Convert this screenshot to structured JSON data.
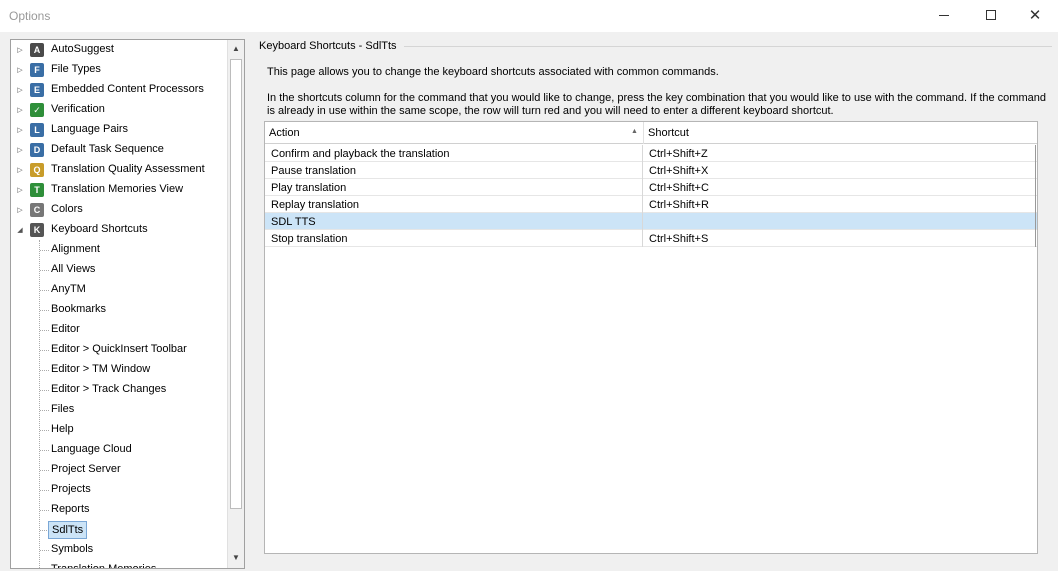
{
  "window": {
    "title": "Options"
  },
  "tree": {
    "items": [
      {
        "label": "AutoSuggest",
        "icon": "autosuggest-icon",
        "color": "#4a4a4a",
        "glyph": "A"
      },
      {
        "label": "File Types",
        "icon": "file-types-icon",
        "color": "#3a6ea5",
        "glyph": "F"
      },
      {
        "label": "Embedded Content Processors",
        "icon": "embedded-content-icon",
        "color": "#3a6ea5",
        "glyph": "E"
      },
      {
        "label": "Verification",
        "icon": "verification-icon",
        "color": "#2f8f3a",
        "glyph": "✓"
      },
      {
        "label": "Language Pairs",
        "icon": "language-pairs-icon",
        "color": "#3a6ea5",
        "glyph": "L"
      },
      {
        "label": "Default Task Sequence",
        "icon": "task-sequence-icon",
        "color": "#3a6ea5",
        "glyph": "D"
      },
      {
        "label": "Translation Quality Assessment",
        "icon": "quality-assessment-icon",
        "color": "#c89c2a",
        "glyph": "Q"
      },
      {
        "label": "Translation Memories View",
        "icon": "translation-memories-icon",
        "color": "#2f8f3a",
        "glyph": "T"
      },
      {
        "label": "Colors",
        "icon": "colors-icon",
        "color": "#777777",
        "glyph": "C"
      },
      {
        "label": "Keyboard Shortcuts",
        "icon": "keyboard-icon",
        "color": "#555555",
        "glyph": "K"
      }
    ],
    "children": [
      {
        "label": "Alignment"
      },
      {
        "label": "All Views"
      },
      {
        "label": "AnyTM"
      },
      {
        "label": "Bookmarks"
      },
      {
        "label": "Editor"
      },
      {
        "label": "Editor > QuickInsert Toolbar"
      },
      {
        "label": "Editor > TM Window"
      },
      {
        "label": "Editor > Track Changes"
      },
      {
        "label": "Files"
      },
      {
        "label": "Help"
      },
      {
        "label": "Language Cloud"
      },
      {
        "label": "Project Server"
      },
      {
        "label": "Projects"
      },
      {
        "label": "Reports"
      },
      {
        "label": "SdlTts"
      },
      {
        "label": "Symbols"
      },
      {
        "label": "Translation Memories"
      }
    ],
    "selected_child": "SdlTts"
  },
  "page": {
    "section_title": "Keyboard Shortcuts - SdlTts",
    "description_1": "This page allows you to change the keyboard shortcuts associated with common commands.",
    "description_2": "In the shortcuts column for the command that you would like to change, press the key combination that you would like to use with the command.  If the command is already in use within the same scope, the row will turn red and you will need to enter a different keyboard shortcut."
  },
  "grid": {
    "columns": {
      "action": "Action",
      "shortcut": "Shortcut"
    },
    "rows": [
      {
        "action": "Confirm and playback the translation",
        "shortcut": "Ctrl+Shift+Z"
      },
      {
        "action": "Pause translation",
        "shortcut": "Ctrl+Shift+X"
      },
      {
        "action": "Play translation",
        "shortcut": "Ctrl+Shift+C"
      },
      {
        "action": "Replay translation",
        "shortcut": "Ctrl+Shift+R"
      },
      {
        "action": "SDL TTS",
        "shortcut": ""
      },
      {
        "action": "Stop translation",
        "shortcut": "Ctrl+Shift+S"
      }
    ],
    "selected_row": "SDL TTS"
  }
}
